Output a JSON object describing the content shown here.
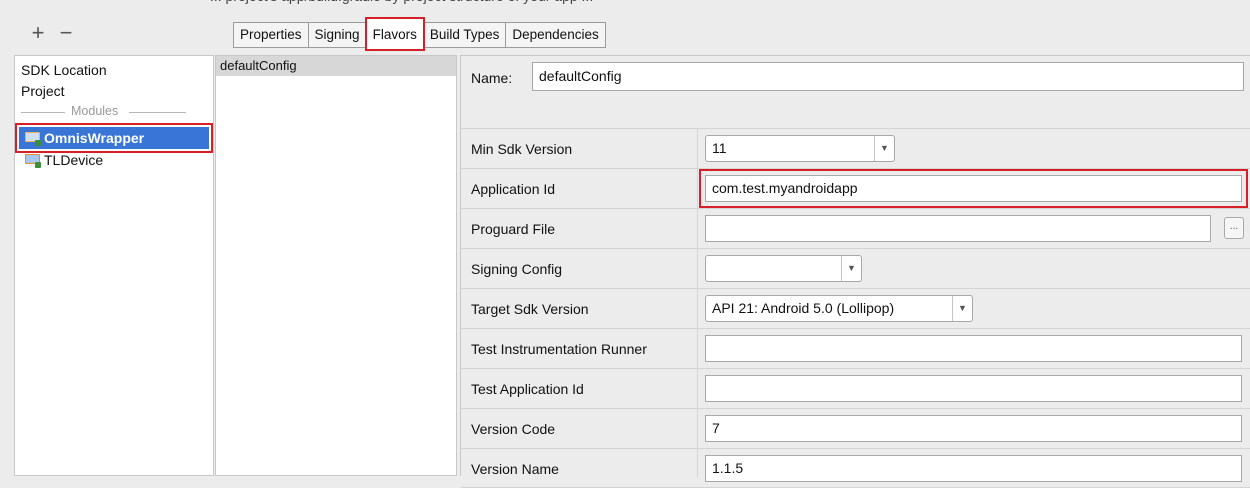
{
  "header": {
    "cutoff_text": "... project's app/build.gradle by project structure of your app ..."
  },
  "toolbar": {
    "plus": "+",
    "minus": "−"
  },
  "tabs": [
    {
      "label": "Properties",
      "active": false
    },
    {
      "label": "Signing",
      "active": false
    },
    {
      "label": "Flavors",
      "active": true
    },
    {
      "label": "Build Types",
      "active": false
    },
    {
      "label": "Dependencies",
      "active": false
    }
  ],
  "sidebar": {
    "items": [
      {
        "label": "SDK Location"
      },
      {
        "label": "Project"
      }
    ],
    "modules_label": "Modules",
    "modules": [
      {
        "label": "OmnisWrapper",
        "selected": true
      },
      {
        "label": "TLDevice",
        "selected": false
      }
    ]
  },
  "flavors": {
    "items": [
      "defaultConfig"
    ]
  },
  "form": {
    "name_label": "Name:",
    "name_value": "defaultConfig",
    "fields": [
      {
        "label": "Min Sdk Version",
        "value": "11",
        "kind": "combo"
      },
      {
        "label": "Application Id",
        "value": "com.test.myandroidapp",
        "kind": "text"
      },
      {
        "label": "Proguard File",
        "value": "",
        "kind": "file",
        "browse_label": "..."
      },
      {
        "label": "Signing Config",
        "value": "",
        "kind": "combo"
      },
      {
        "label": "Target Sdk Version",
        "value": "API 21: Android 5.0 (Lollipop)",
        "kind": "combo"
      },
      {
        "label": "Test Instrumentation Runner",
        "value": "",
        "kind": "text"
      },
      {
        "label": "Test Application Id",
        "value": "",
        "kind": "text"
      },
      {
        "label": "Version Code",
        "value": "7",
        "kind": "text"
      },
      {
        "label": "Version Name",
        "value": "1.1.5",
        "kind": "text"
      }
    ]
  },
  "colors": {
    "highlight_red": "#d61f26",
    "selection_blue": "#3875d7"
  }
}
